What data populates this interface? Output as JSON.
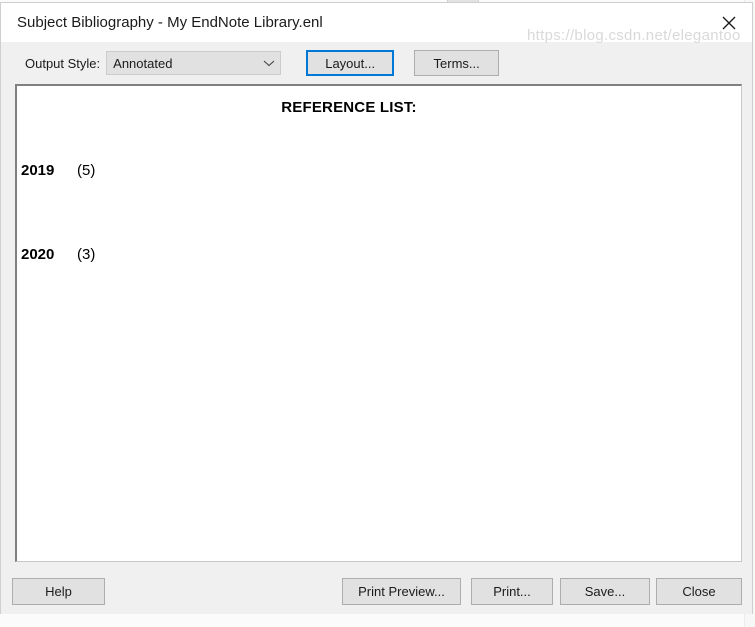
{
  "window": {
    "title": "Subject Bibliography - My EndNote Library.enl",
    "close_icon": "close-icon"
  },
  "toolbar": {
    "output_style_label": "Output Style:",
    "output_style_value": "Annotated",
    "output_style_options": [
      "Annotated"
    ],
    "dropdown_icon": "chevron-down-icon",
    "layout_button": "Layout...",
    "terms_button": "Terms..."
  },
  "document": {
    "heading": "REFERENCE LIST:",
    "entries": [
      {
        "term": "2019",
        "count": "(5)"
      },
      {
        "term": "2020",
        "count": "(3)"
      }
    ]
  },
  "footer": {
    "help_button": "Help",
    "print_preview_button": "Print Preview...",
    "print_button": "Print...",
    "save_button": "Save...",
    "close_button": "Close"
  },
  "watermark": {
    "text": "https://blog.csdn.net/elegantoo"
  },
  "colors": {
    "accent": "#0078d7",
    "window_background": "#f0f0f0",
    "control_background": "#e1e1e1",
    "document_background": "#ffffff",
    "text": "#1b1b1b"
  }
}
